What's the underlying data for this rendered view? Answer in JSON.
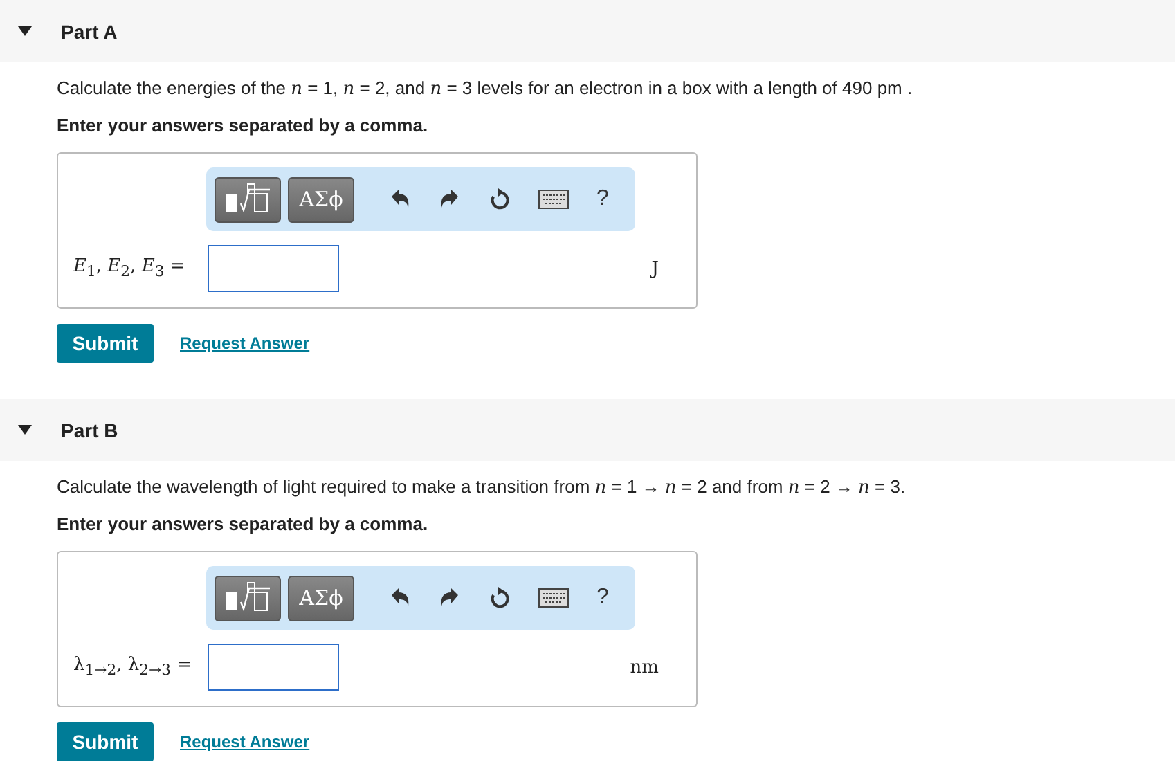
{
  "parts": [
    {
      "title": "Part A",
      "expanded": true,
      "prompt": "Calculate the energies of the *n* = 1, *n* = 2, and *n* = 3 levels for an electron in a box with a length of 490 pm .",
      "instruction": "Enter your answers separated by a comma.",
      "toolbar": {
        "symbols": "ΑΣϕ",
        "help": "?"
      },
      "answer_label": "*E*$_{1}$, *E*$_{2}$, *E*$_{3}$ =",
      "unit": "J",
      "submit": "Submit",
      "request": "Request Answer"
    },
    {
      "title": "Part B",
      "expanded": true,
      "prompt": "Calculate the wavelength of light required to make a transition from *n* = 1 → *n* = 2 and from *n* = 2 → *n* = 3.",
      "instruction": "Enter your answers separated by a comma.",
      "toolbar": {
        "symbols": "ΑΣϕ",
        "help": "?"
      },
      "answer_label": "λ$_{1→2}$, λ$_{2→3}$ =",
      "unit": "nm",
      "submit": "Submit",
      "request": "Request Answer"
    }
  ]
}
